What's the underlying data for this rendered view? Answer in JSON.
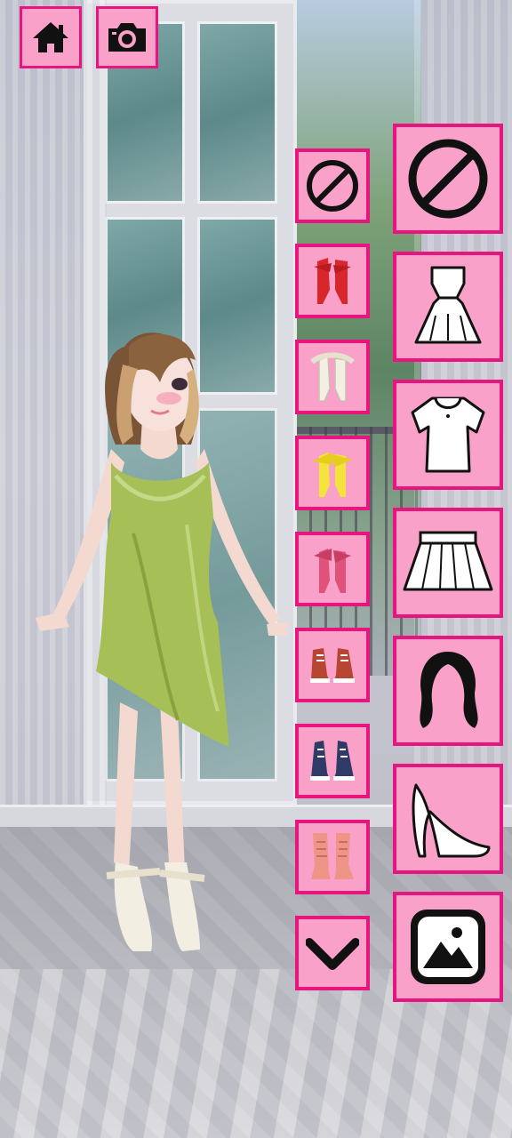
{
  "toolbar": {
    "home_icon": "home-icon",
    "camera_icon": "camera-icon"
  },
  "colors": {
    "button_fill": "#f9a1c8",
    "button_border": "#e8157f",
    "dress": "#a6bf57"
  },
  "item_column": [
    {
      "name": "none",
      "icon": "no-symbol-icon"
    },
    {
      "name": "red-ribbon-heels",
      "icon": "red-heels-icon"
    },
    {
      "name": "white-ribbon-heels",
      "icon": "white-heels-icon"
    },
    {
      "name": "yellow-ribbon-heels",
      "icon": "yellow-heels-icon"
    },
    {
      "name": "pink-ribbon-heels",
      "icon": "pink-heels-icon"
    },
    {
      "name": "red-sneakers",
      "icon": "red-sneakers-icon"
    },
    {
      "name": "navy-sneakers",
      "icon": "navy-sneakers-icon"
    },
    {
      "name": "pink-boots",
      "icon": "pink-boots-icon"
    },
    {
      "name": "scroll-down",
      "icon": "chevron-down-icon"
    }
  ],
  "category_column": [
    {
      "name": "remove",
      "icon": "no-symbol-icon"
    },
    {
      "name": "dress",
      "icon": "dress-icon"
    },
    {
      "name": "top",
      "icon": "blouse-icon"
    },
    {
      "name": "skirt",
      "icon": "skirt-icon"
    },
    {
      "name": "hair",
      "icon": "hair-icon"
    },
    {
      "name": "shoes",
      "icon": "high-heel-icon"
    },
    {
      "name": "background",
      "icon": "image-icon"
    }
  ]
}
